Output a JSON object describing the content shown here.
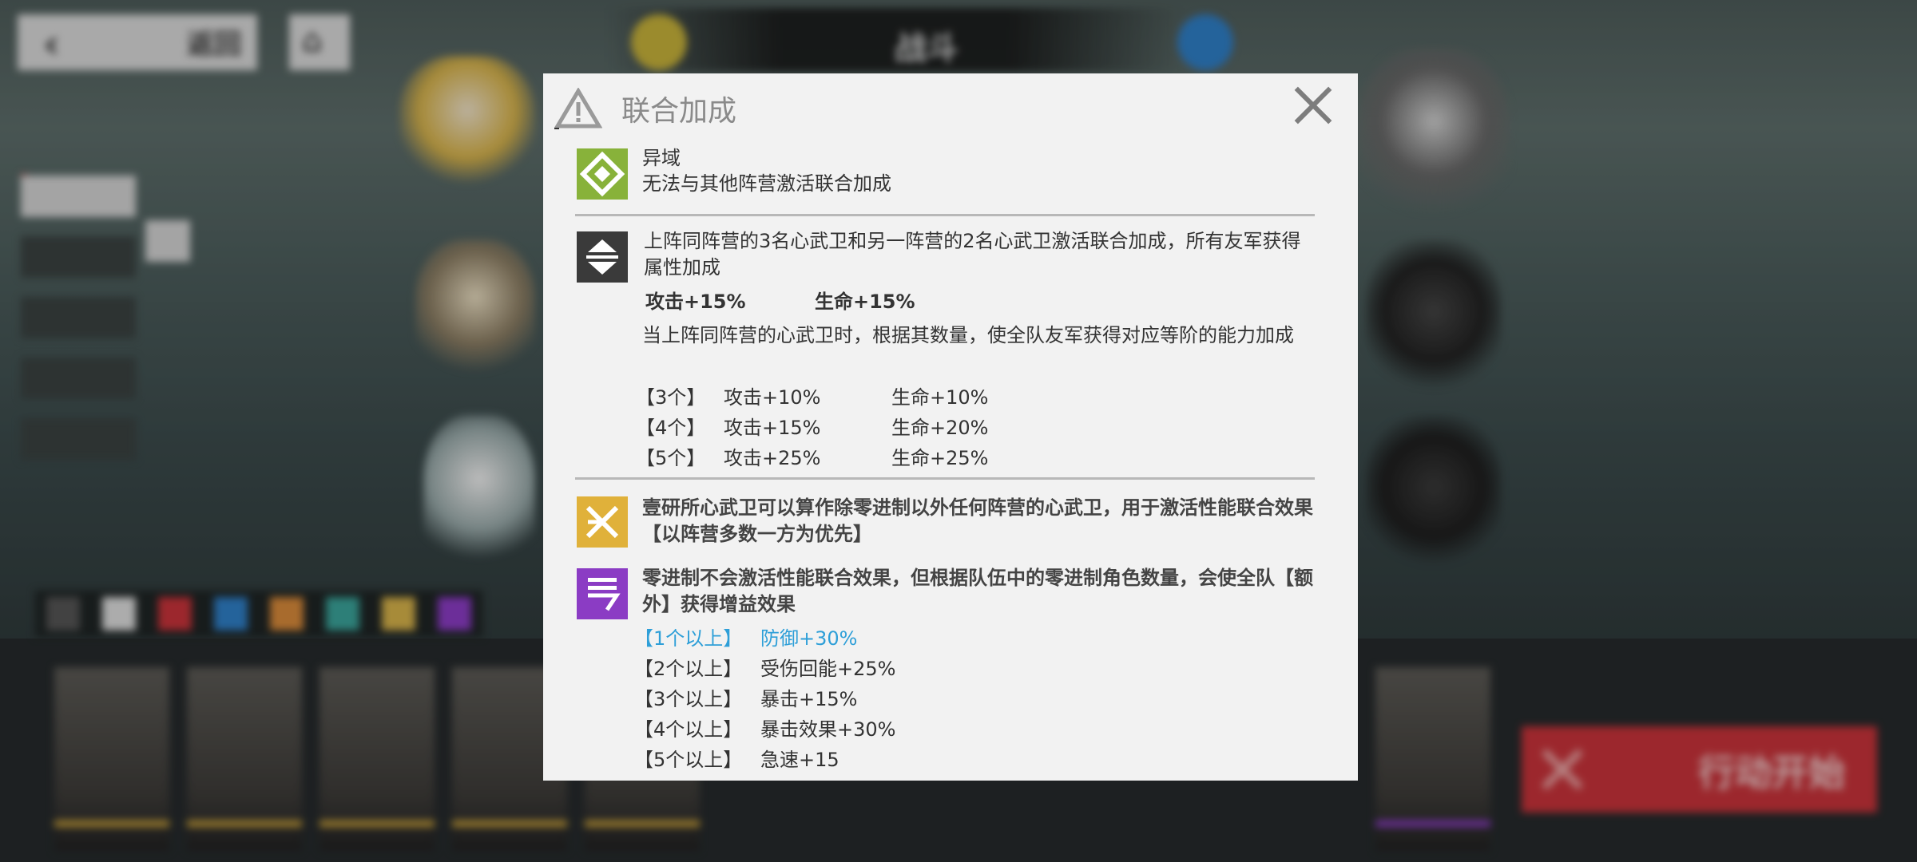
{
  "background": {
    "back_label": "返回",
    "top_title": "战斗",
    "start_button_label": "行动开始"
  },
  "dialog": {
    "title": "联合加成",
    "other_faction": {
      "name": "异域",
      "desc": "无法与其他阵营激活联合加成"
    },
    "union_bonus": {
      "desc": "上阵同阵营的3名心武卫和另一阵营的2名心武卫激活联合加成，所有友军获得属性加成",
      "attack": "攻击+15%",
      "hp": "生命+15%",
      "tier_desc": "当上阵同阵营的心武卫时，根据其数量，使全队友军获得对应等阶的能力加成",
      "tiers": [
        {
          "count": "【3个】",
          "attack": "攻击+10%",
          "hp": "生命+10%"
        },
        {
          "count": "【4个】",
          "attack": "攻击+15%",
          "hp": "生命+20%"
        },
        {
          "count": "【5个】",
          "attack": "攻击+25%",
          "hp": "生命+25%"
        }
      ]
    },
    "yiyan_note": "壹研所心武卫可以算作除零进制以外任何阵营的心武卫，用于激活性能联合效果【以阵营多数一方为优先】",
    "zero_note": "零进制不会激活性能联合效果，但根据队伍中的零进制角色数量，会使全队【额外】获得增益效果",
    "zero_tiers": [
      {
        "count": "【1个以上】",
        "effect": "防御+30%"
      },
      {
        "count": "【2个以上】",
        "effect": "受伤回能+25%"
      },
      {
        "count": "【3个以上】",
        "effect": "暴击+15%"
      },
      {
        "count": "【4个以上】",
        "effect": "暴击效果+30%"
      },
      {
        "count": "【5个以上】",
        "effect": "急速+15"
      }
    ]
  },
  "colors": {
    "highlight_text": "#2e9fd8",
    "start_button": "#c8333a",
    "icon_other": "#88b23a",
    "icon_yiyan": "#e0b13a",
    "icon_zero": "#8b3cc4"
  }
}
